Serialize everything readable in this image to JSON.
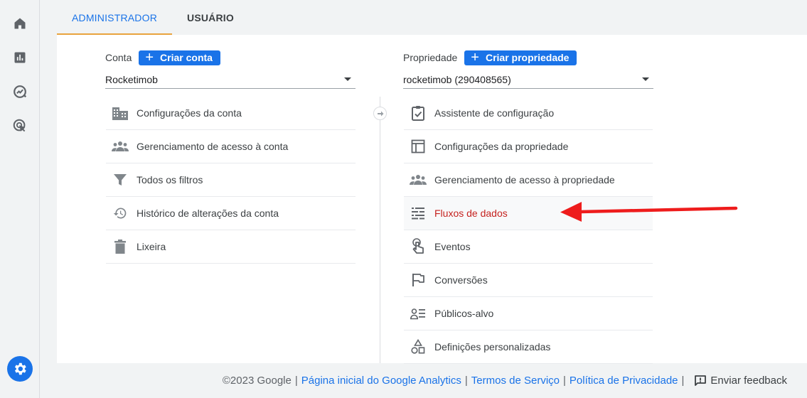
{
  "tabs": [
    {
      "label": "ADMINISTRADOR",
      "active": true
    },
    {
      "label": "USUÁRIO",
      "active": false
    }
  ],
  "account": {
    "label": "Conta",
    "create_label": "Criar conta",
    "selected": "Rocketimob",
    "items": [
      {
        "label": "Configurações da conta",
        "icon": "building-icon"
      },
      {
        "label": "Gerenciamento de acesso à conta",
        "icon": "people-icon"
      },
      {
        "label": "Todos os filtros",
        "icon": "filter-icon"
      },
      {
        "label": "Histórico de alterações da conta",
        "icon": "history-icon"
      },
      {
        "label": "Lixeira",
        "icon": "trash-icon"
      }
    ]
  },
  "property": {
    "label": "Propriedade",
    "create_label": "Criar propriedade",
    "selected": "rocketimob (290408565)",
    "items": [
      {
        "label": "Assistente de configuração",
        "icon": "clipboard-check-icon"
      },
      {
        "label": "Configurações da propriedade",
        "icon": "layout-icon"
      },
      {
        "label": "Gerenciamento de acesso à propriedade",
        "icon": "people-icon"
      },
      {
        "label": "Fluxos de dados",
        "icon": "data-streams-icon",
        "highlighted": true
      },
      {
        "label": "Eventos",
        "icon": "touch-icon"
      },
      {
        "label": "Conversões",
        "icon": "flag-icon"
      },
      {
        "label": "Públicos-alvo",
        "icon": "audience-icon"
      },
      {
        "label": "Definições personalizadas",
        "icon": "shapes-icon"
      }
    ]
  },
  "footer": {
    "copyright": "©2023 Google",
    "links": [
      "Página inicial do Google Analytics",
      "Termos de Serviço",
      "Política de Privacidade"
    ],
    "feedback": "Enviar feedback"
  },
  "colors": {
    "accent": "#1a73e8",
    "highlight_text": "#c5221f",
    "annotation_arrow": "#ee1c1c",
    "tab_indicator": "#e8a33d"
  }
}
